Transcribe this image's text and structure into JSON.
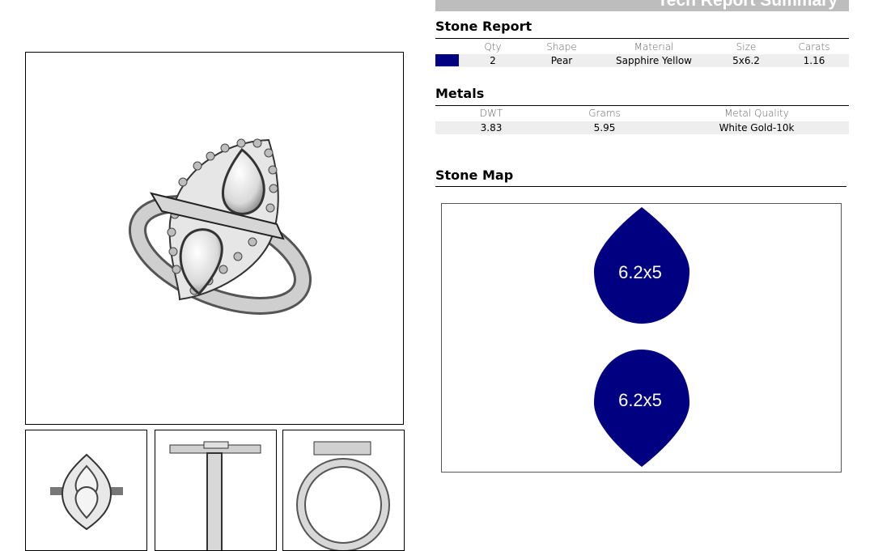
{
  "header": {
    "title": "Tech Report Summary"
  },
  "stone_report": {
    "title": "Stone Report",
    "columns": [
      "Qty",
      "Shape",
      "Material",
      "Size",
      "Carats"
    ],
    "row": {
      "color": "#000080",
      "qty": "2",
      "shape": "Pear",
      "material": "Sapphire Yellow",
      "size": "5x6.2",
      "carats": "1.16"
    }
  },
  "metals": {
    "title": "Metals",
    "columns": [
      "DWT",
      "Grams",
      "Metal Quality"
    ],
    "row": {
      "dwt": "3.83",
      "grams": "5.95",
      "quality": "White Gold-10k"
    }
  },
  "stone_map": {
    "title": "Stone Map",
    "stones": [
      {
        "label": "6.2x5",
        "orientation": "point-up"
      },
      {
        "label": "6.2x5",
        "orientation": "point-down"
      }
    ]
  },
  "colors": {
    "stone": "#000080",
    "banner": "#bdbdbd",
    "row_bg": "#eeeeee"
  }
}
